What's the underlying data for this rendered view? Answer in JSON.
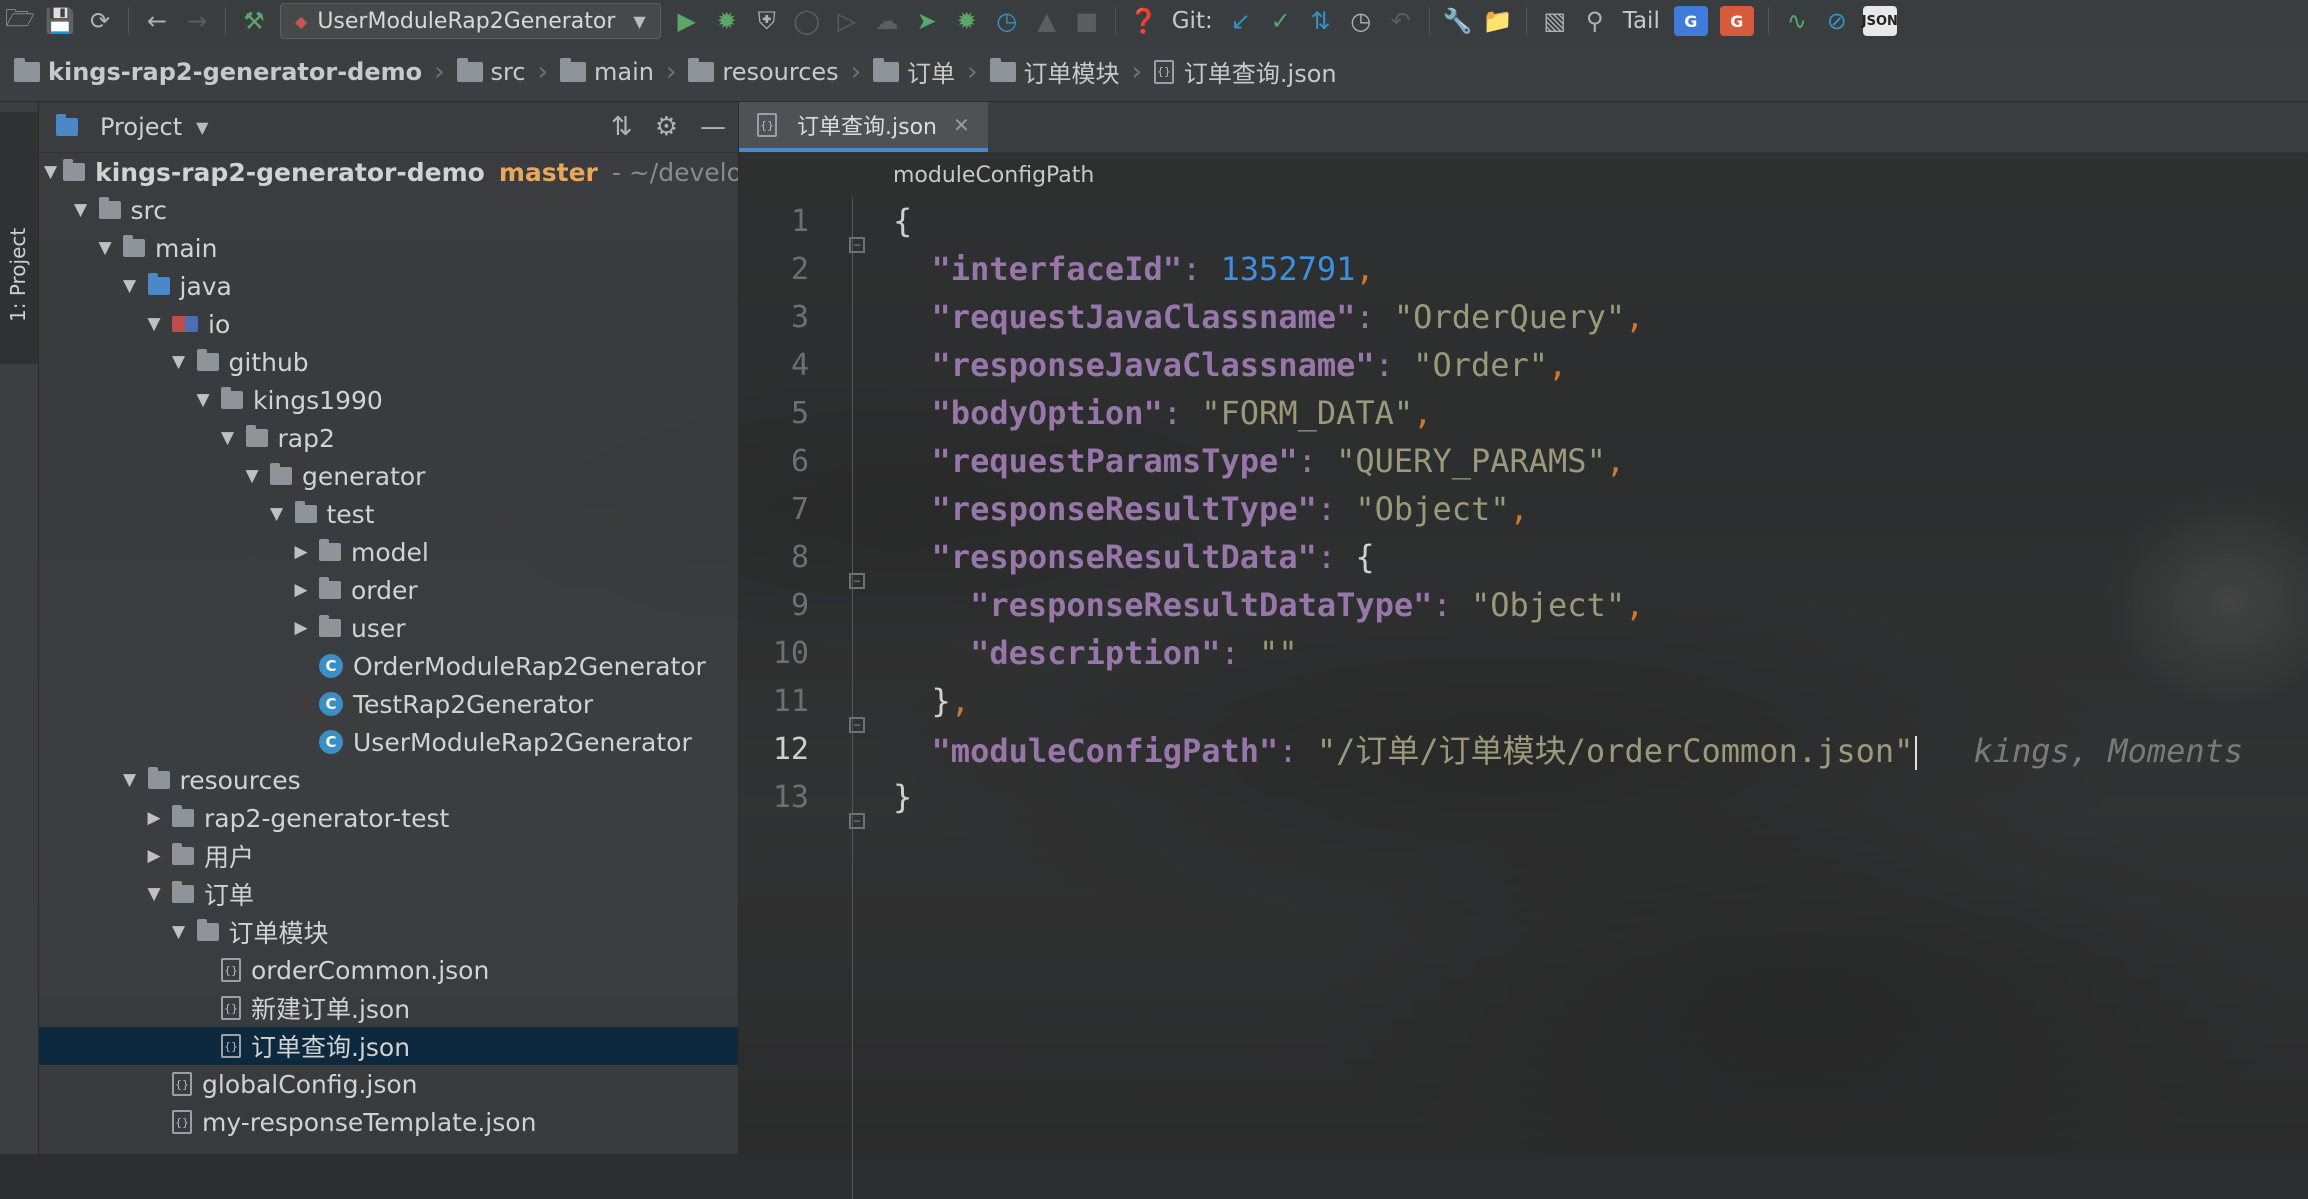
{
  "toolbar": {
    "run_config": "UserModuleRap2Generator",
    "git_label": "Git:",
    "tail_label": "Tail",
    "json_badge": "JSON"
  },
  "breadcrumb": [
    "kings-rap2-generator-demo",
    "src",
    "main",
    "resources",
    "订单",
    "订单模块",
    "订单查询.json"
  ],
  "project_panel": {
    "title": "Project",
    "side_tab": "1: Project",
    "root": {
      "name": "kings-rap2-generator-demo",
      "branch": "master",
      "path": "- ~/develo"
    },
    "tree": [
      {
        "label": "src",
        "depth": 1,
        "kind": "folder",
        "arrow": "open"
      },
      {
        "label": "main",
        "depth": 2,
        "kind": "folder",
        "arrow": "open"
      },
      {
        "label": "java",
        "depth": 3,
        "kind": "folder-blue",
        "arrow": "open"
      },
      {
        "label": "io",
        "depth": 4,
        "kind": "package",
        "arrow": "open"
      },
      {
        "label": "github",
        "depth": 5,
        "kind": "folder",
        "arrow": "open"
      },
      {
        "label": "kings1990",
        "depth": 6,
        "kind": "folder",
        "arrow": "open"
      },
      {
        "label": "rap2",
        "depth": 7,
        "kind": "folder",
        "arrow": "open"
      },
      {
        "label": "generator",
        "depth": 8,
        "kind": "folder",
        "arrow": "open"
      },
      {
        "label": "test",
        "depth": 9,
        "kind": "folder",
        "arrow": "open"
      },
      {
        "label": "model",
        "depth": 10,
        "kind": "folder",
        "arrow": "closed"
      },
      {
        "label": "order",
        "depth": 10,
        "kind": "folder",
        "arrow": "closed"
      },
      {
        "label": "user",
        "depth": 10,
        "kind": "folder",
        "arrow": "closed"
      },
      {
        "label": "OrderModuleRap2Generator",
        "depth": 10,
        "kind": "class",
        "arrow": "none"
      },
      {
        "label": "TestRap2Generator",
        "depth": 10,
        "kind": "class",
        "arrow": "none"
      },
      {
        "label": "UserModuleRap2Generator",
        "depth": 10,
        "kind": "class",
        "arrow": "none"
      },
      {
        "label": "resources",
        "depth": 3,
        "kind": "folder",
        "arrow": "open"
      },
      {
        "label": "rap2-generator-test",
        "depth": 4,
        "kind": "folder",
        "arrow": "closed"
      },
      {
        "label": "用户",
        "depth": 4,
        "kind": "folder",
        "arrow": "closed"
      },
      {
        "label": "订单",
        "depth": 4,
        "kind": "folder",
        "arrow": "open"
      },
      {
        "label": "订单模块",
        "depth": 5,
        "kind": "folder",
        "arrow": "open"
      },
      {
        "label": "orderCommon.json",
        "depth": 6,
        "kind": "json",
        "arrow": "none"
      },
      {
        "label": "新建订单.json",
        "depth": 6,
        "kind": "json",
        "arrow": "none"
      },
      {
        "label": "订单查询.json",
        "depth": 6,
        "kind": "json",
        "arrow": "none",
        "selected": true
      },
      {
        "label": "globalConfig.json",
        "depth": 4,
        "kind": "json",
        "arrow": "none"
      },
      {
        "label": "my-responseTemplate.json",
        "depth": 4,
        "kind": "json",
        "arrow": "none"
      }
    ]
  },
  "editor": {
    "tab_label": "订单查询.json",
    "structure_path": "moduleConfigPath",
    "blame": "kings, Moments",
    "lines": [
      {
        "n": "1",
        "t": [
          [
            "br",
            "{"
          ]
        ],
        "fold": true
      },
      {
        "n": "2",
        "t": [
          [
            "ind",
            "  "
          ],
          [
            "k",
            "\"interfaceId\""
          ],
          [
            "k2",
            ": "
          ],
          [
            "n",
            "1352791"
          ],
          [
            "p",
            ","
          ]
        ]
      },
      {
        "n": "3",
        "t": [
          [
            "ind",
            "  "
          ],
          [
            "k",
            "\"requestJavaClassname\""
          ],
          [
            "k2",
            ": "
          ],
          [
            "s",
            "\"OrderQuery\""
          ],
          [
            "p",
            ","
          ]
        ]
      },
      {
        "n": "4",
        "t": [
          [
            "ind",
            "  "
          ],
          [
            "k",
            "\"responseJavaClassname\""
          ],
          [
            "k2",
            ": "
          ],
          [
            "s",
            "\"Order\""
          ],
          [
            "p",
            ","
          ]
        ]
      },
      {
        "n": "5",
        "t": [
          [
            "ind",
            "  "
          ],
          [
            "k",
            "\"bodyOption\""
          ],
          [
            "k2",
            ": "
          ],
          [
            "s",
            "\"FORM_DATA\""
          ],
          [
            "p",
            ","
          ]
        ]
      },
      {
        "n": "6",
        "t": [
          [
            "ind",
            "  "
          ],
          [
            "k",
            "\"requestParamsType\""
          ],
          [
            "k2",
            ": "
          ],
          [
            "s",
            "\"QUERY_PARAMS\""
          ],
          [
            "p",
            ","
          ]
        ]
      },
      {
        "n": "7",
        "t": [
          [
            "ind",
            "  "
          ],
          [
            "k",
            "\"responseResultType\""
          ],
          [
            "k2",
            ": "
          ],
          [
            "s",
            "\"Object\""
          ],
          [
            "p",
            ","
          ]
        ]
      },
      {
        "n": "8",
        "t": [
          [
            "ind",
            "  "
          ],
          [
            "k",
            "\"responseResultData\""
          ],
          [
            "k2",
            ": "
          ],
          [
            "br",
            "{"
          ]
        ],
        "fold": true
      },
      {
        "n": "9",
        "t": [
          [
            "ind",
            "    "
          ],
          [
            "k",
            "\"responseResultDataType\""
          ],
          [
            "k2",
            ": "
          ],
          [
            "s",
            "\"Object\""
          ],
          [
            "p",
            ","
          ]
        ]
      },
      {
        "n": "10",
        "t": [
          [
            "ind",
            "    "
          ],
          [
            "k",
            "\"description\""
          ],
          [
            "k2",
            ": "
          ],
          [
            "s",
            "\"\""
          ]
        ]
      },
      {
        "n": "11",
        "t": [
          [
            "ind",
            "  "
          ],
          [
            "br",
            "}"
          ],
          [
            "p",
            ","
          ]
        ],
        "fold": true
      },
      {
        "n": "12",
        "t": [
          [
            "ind",
            "  "
          ],
          [
            "k",
            "\"moduleConfigPath\""
          ],
          [
            "k2",
            ": "
          ],
          [
            "s",
            "\"/订单/订单模块/orderCommon.json\""
          ]
        ],
        "current": true
      },
      {
        "n": "13",
        "t": [
          [
            "br",
            "}"
          ]
        ],
        "fold": true
      }
    ]
  }
}
